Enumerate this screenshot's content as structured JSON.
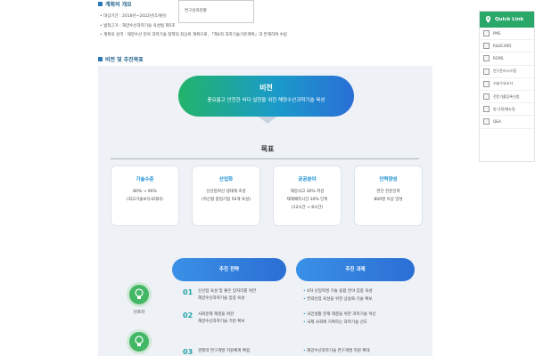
{
  "section1": {
    "title": "계획의 개요",
    "bullets": [
      "대상기간 : 2018년~2022년(5개년)",
      "법적근거 : 해양수산과학기술 육성법 제5조",
      "계획의 성격 : 해양수산 분야 과학기술 정책의 최상위 계획으로, 「제4차 과학기술기본계획」과 연계하여 수립"
    ]
  },
  "dropdown": {
    "value": "연구성과현황"
  },
  "section2": {
    "title": "비전 및 추진목표"
  },
  "vision": {
    "title": "비전",
    "subtitle": "풍요롭고 안전한 바다 실현을 위한 해양수산과학기술 육성"
  },
  "goal_label": "목표",
  "goals": [
    {
      "title": "기술수준",
      "lines": [
        "80% → 90%",
        "(최고기술보유국대비)"
      ]
    },
    {
      "title": "산업화",
      "lines": [
        "신산업혁신 생태계 조성",
        "(혁신형 창업기업 50개 육성)"
      ]
    },
    {
      "title": "공공분야",
      "lines": [
        "해양사고 30% 저감",
        "재해예측시간 30% 단축",
        "(12시간 → 8시간)"
      ]
    },
    {
      "title": "인력양성",
      "lines": [
        "연간 전문인력",
        "800명 이상 양성"
      ]
    }
  ],
  "strategy_header": "추진 전략",
  "task_header": "추진 과제",
  "circle1_label": "인프라",
  "strategies": [
    {
      "num": "01",
      "lines": [
        "신산업 육성 및 좋은 일자리를 위한",
        "해양수산과학기술 집중 육성"
      ]
    },
    {
      "num": "02",
      "lines": [
        "사회문제 해결을 위한",
        "해양수산과학기술 기반 확보"
      ]
    },
    {
      "num": "03",
      "lines": [
        "경쟁력 연구개발 지원체계 확립"
      ]
    }
  ],
  "tasks": [
    [
      "4차 산업혁명 기술 융합 분야 집중 육성",
      "전략산업 육성을 위한 상용화 기술 확보"
    ],
    [
      "국민생활 문제 해결을 위한 과학기술 혁신",
      "국제 사회에 기여하는 과학기술 선도"
    ],
    [
      "해양수산과학기술 연구개발 지원 확대"
    ]
  ],
  "quicklink": {
    "title": "Quick Link",
    "items": [
      "PMS",
      "R&DCARD",
      "RCMS",
      "연구윤리시스템",
      "기술수요조사",
      "전문가풀등록신청",
      "법·규정/매뉴얼",
      "Q&A"
    ]
  },
  "colors": {
    "accent_green": "#2aa86a",
    "accent_blue": "#2b6fd4",
    "number_teal": "#22a3a6"
  }
}
